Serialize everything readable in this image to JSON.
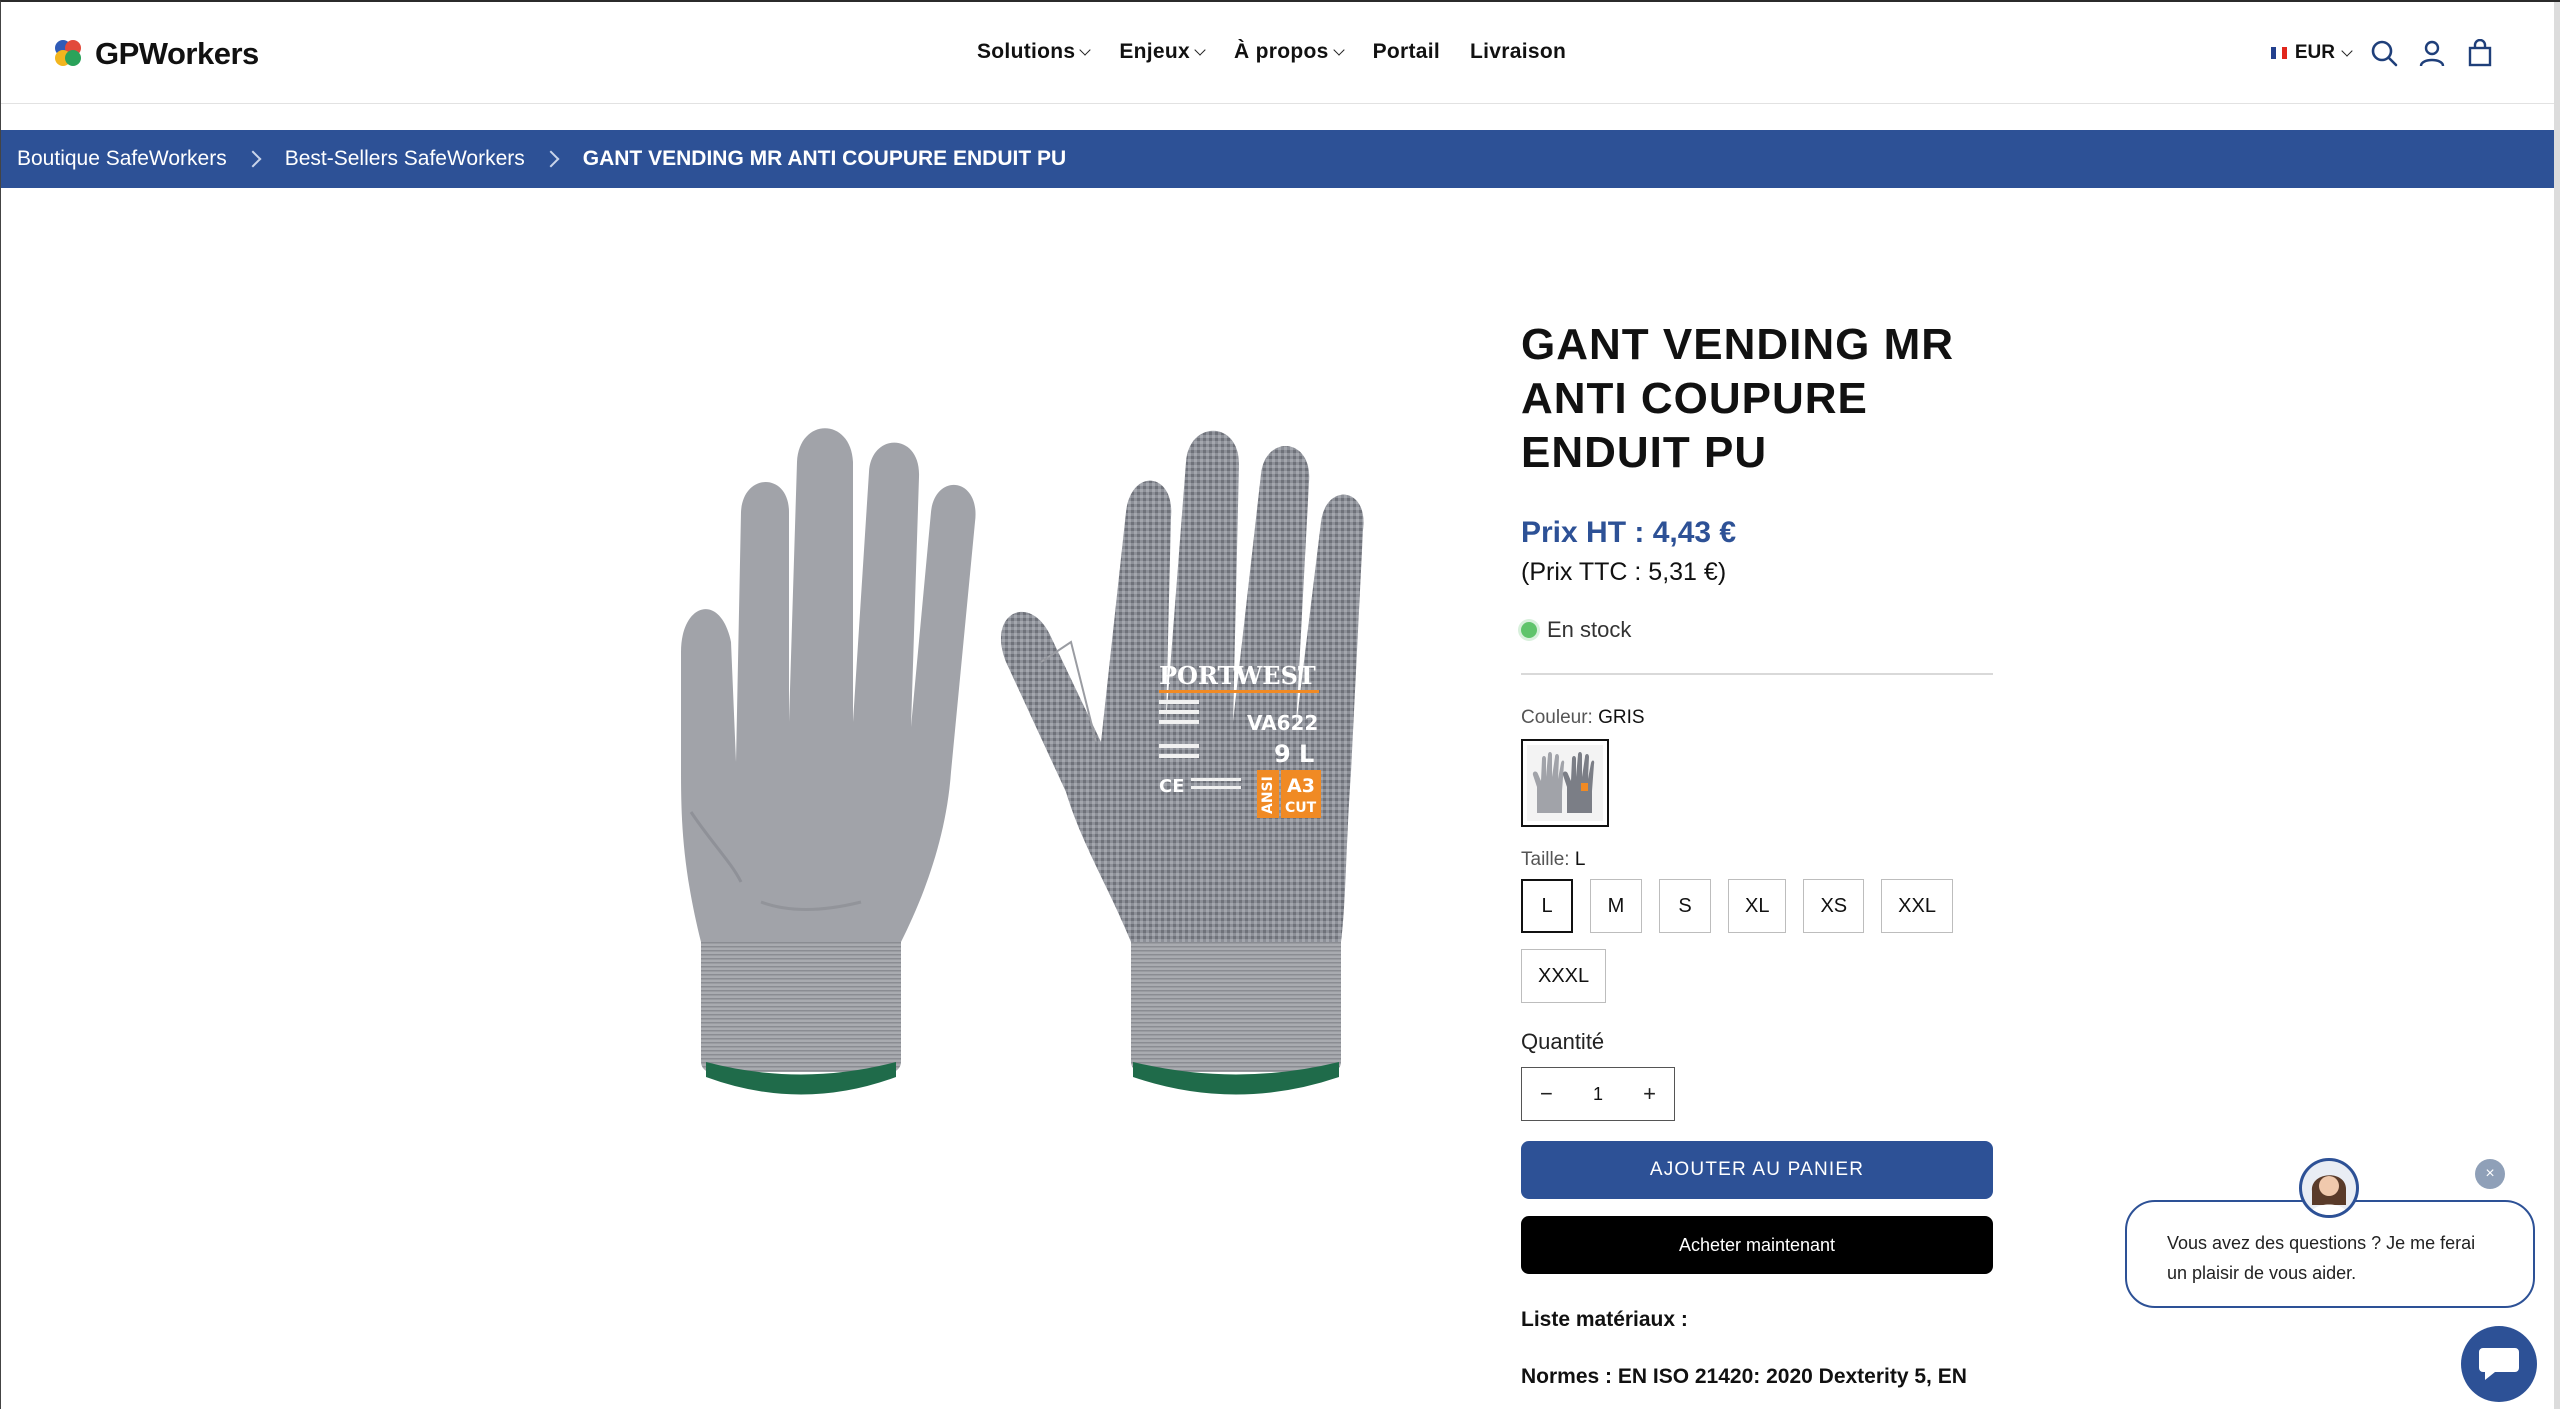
{
  "header": {
    "logo_text": "GPWorkers",
    "nav": [
      "Solutions",
      "Enjeux",
      "À propos",
      "Portail",
      "Livraison"
    ],
    "currency": "EUR"
  },
  "breadcrumb": [
    "Boutique SafeWorkers",
    "Best-Sellers SafeWorkers",
    "GANT VENDING MR ANTI COUPURE ENDUIT PU"
  ],
  "product": {
    "title": "GANT VENDING MR ANTI COUPURE ENDUIT PU",
    "price_ht": "Prix HT : 4,43 €",
    "price_ttc": "(Prix TTC : 5,31 €)",
    "stock": "En stock",
    "color_label": "Couleur:",
    "color_value": "GRIS",
    "size_label": "Taille:",
    "size_value": "L",
    "sizes": [
      "L",
      "M",
      "S",
      "XL",
      "XS",
      "XXL",
      "XXXL"
    ],
    "quantity_label": "Quantité",
    "quantity": "1",
    "add_to_cart": "AJOUTER AU PANIER",
    "buy_now": "Acheter maintenant",
    "materials_label": "Liste matériaux :",
    "norms_text": "Normes : EN ISO 21420: 2020 Dexterity 5, EN"
  },
  "glove_print": {
    "brand": "PORTWEST",
    "model": "VA622",
    "size": "9 L",
    "ansi": "ANSI",
    "cut_level": "A3",
    "cut": "CUT"
  },
  "chat": {
    "message": "Vous avez des questions ? Je me ferai un plaisir de vous aider.",
    "close": "×"
  },
  "colors": {
    "brand_blue": "#2d5196",
    "in_stock": "#5fc46b"
  }
}
